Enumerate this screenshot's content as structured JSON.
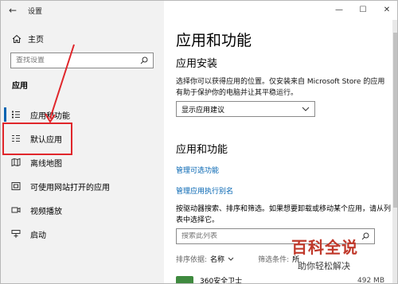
{
  "window": {
    "title": "设置"
  },
  "titlebar": {
    "back": "←",
    "minimize": "—",
    "maximize": "☐",
    "close": "✕"
  },
  "sidebar": {
    "home_label": "主页",
    "search_placeholder": "查找设置",
    "section_label": "应用",
    "items": [
      {
        "label": "应用和功能",
        "icon": "apps-features-icon"
      },
      {
        "label": "默认应用",
        "icon": "default-apps-icon"
      },
      {
        "label": "离线地图",
        "icon": "offline-maps-icon"
      },
      {
        "label": "可使用网站打开的应用",
        "icon": "apps-for-websites-icon"
      },
      {
        "label": "视频播放",
        "icon": "video-playback-icon"
      },
      {
        "label": "启动",
        "icon": "startup-icon"
      }
    ]
  },
  "main": {
    "title": "应用和功能",
    "install_heading": "应用安装",
    "install_desc": "选择你可以获得应用的位置。仅安装来自 Microsoft Store 的应用有助于保护你的电脑并让其平稳运行。",
    "install_dropdown": "显示应用建议",
    "apps_heading": "应用和功能",
    "link_optional": "管理可选功能",
    "link_aliases": "管理应用执行别名",
    "sort_desc": "按驱动器搜索、排序和筛选。如果想要卸载或移动某个应用，请从列表中选择它。",
    "list_search_placeholder": "搜索此列表",
    "sort_label": "排序依据:",
    "sort_value": "名称",
    "filter_label": "筛选条件:",
    "filter_value": "所",
    "first_app_name": "360安全卫士",
    "first_app_size": "492 MB"
  },
  "watermark": {
    "title": "百科全说",
    "subtitle": "助你轻松解决"
  },
  "colors": {
    "accent": "#0063b1",
    "highlight": "#e0262b",
    "sidebar_bg": "#f2f2f2"
  }
}
